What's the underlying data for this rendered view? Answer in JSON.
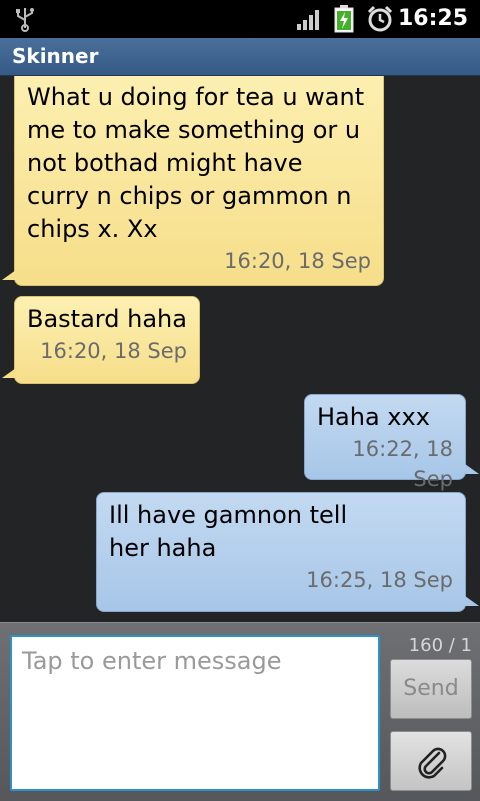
{
  "status_bar": {
    "time": "16:25",
    "icons": [
      "usb-icon",
      "signal-icon",
      "battery-charging-icon",
      "alarm-icon"
    ]
  },
  "header": {
    "title": "Skinner"
  },
  "messages": [
    {
      "direction": "incoming",
      "text": "What u doing for tea u want me to make something or u not bothad might have curry n chips or gammon n chips x. Xx",
      "time": "16:20, 18 Sep"
    },
    {
      "direction": "incoming",
      "text": "Bastard haha",
      "time": "16:20, 18 Sep"
    },
    {
      "direction": "outgoing",
      "text": "Haha xxx",
      "time": "16:22, 18 Sep"
    },
    {
      "direction": "outgoing",
      "text": "Ill have gamnon tell her haha",
      "time": "16:25, 18 Sep"
    }
  ],
  "compose": {
    "placeholder": "Tap to enter message",
    "counter": "160 / 1",
    "send_label": "Send",
    "attach_icon": "paperclip-icon"
  },
  "colors": {
    "incoming_bubble": "#f6de8a",
    "outgoing_bubble": "#a7c6e8",
    "title_bar": "#355a86",
    "input_focus": "#2a93c9"
  }
}
